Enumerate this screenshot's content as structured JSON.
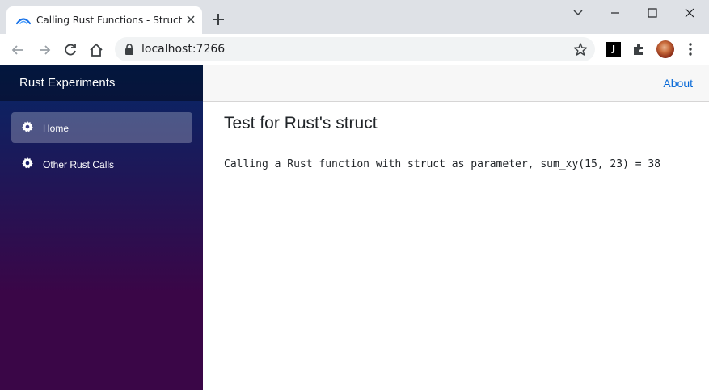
{
  "browser": {
    "tab_title": "Calling Rust Functions - Struct",
    "url": "localhost:7266",
    "extension_label": "J"
  },
  "sidebar": {
    "brand": "Rust Experiments",
    "items": [
      {
        "label": "Home",
        "icon": "gear-icon",
        "active": true
      },
      {
        "label": "Other Rust Calls",
        "icon": "gear-icon",
        "active": false
      }
    ]
  },
  "top_row": {
    "about_label": "About"
  },
  "main": {
    "title": "Test for Rust's struct",
    "result_text": "Calling a Rust function with struct as parameter, sum_xy(15, 23) = 38"
  },
  "colors": {
    "sidebar_top": "#052767",
    "sidebar_bottom": "#3a0647",
    "link": "#0366d6"
  }
}
